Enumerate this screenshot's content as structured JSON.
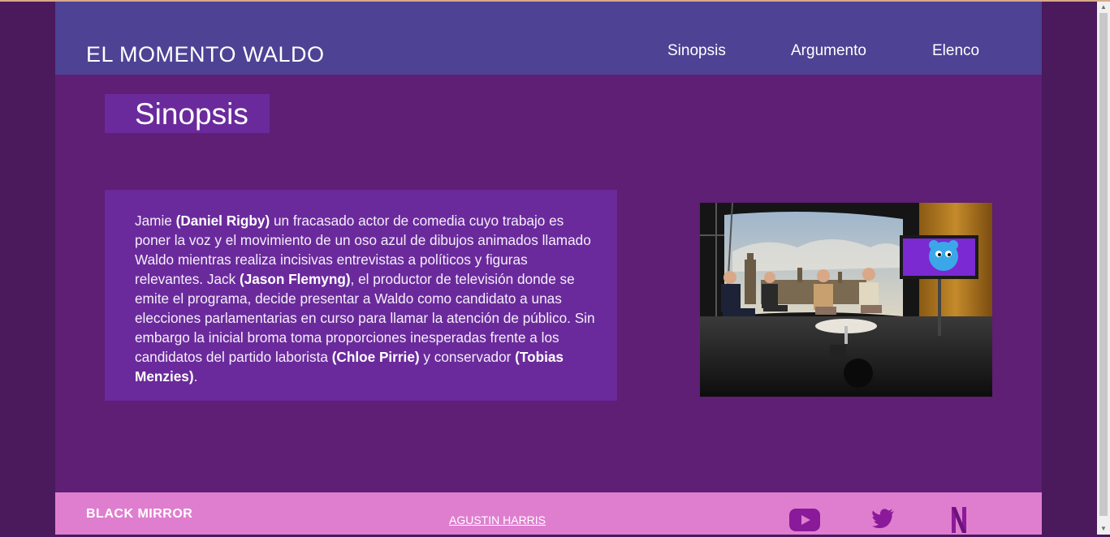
{
  "header": {
    "brand": "EL MOMENTO WALDO",
    "nav": [
      "Sinopsis",
      "Argumento",
      "Elenco"
    ]
  },
  "main": {
    "title": "Sinopsis",
    "synopsis": {
      "p1": "Jamie ",
      "b1": "(Daniel Rigby)",
      "p2": " un fracasado actor de comedia cuyo trabajo es poner la voz y el movimiento de un oso azul de dibujos animados llamado Waldo mientras realiza incisivas entrevistas a políticos y figuras relevantes. Jack ",
      "b2": "(Jason Flemyng)",
      "p3": ", el productor de televisión donde se emite el programa, decide presentar a Waldo como candidato a unas elecciones parlamentarias en curso para llamar la atención de público. Sin embargo la inicial broma toma proporciones inesperadas frente a los candidatos del partido laborista ",
      "b3": "(Chloe Pirrie)",
      "p4": " y conservador ",
      "b4": "(Tobias Menzies)",
      "p5": "."
    },
    "image": {
      "icon": "tv-studio-debate-photo"
    }
  },
  "footer": {
    "logo": "BLACK MIRROR",
    "author_link": "AGUSTIN HARRIS",
    "social": [
      "youtube-icon",
      "twitter-icon",
      "netflix-icon"
    ]
  },
  "colors": {
    "header_bg": "#4d4294",
    "page_bg": "#5e1f74",
    "panel_bg": "#6a2a9c",
    "footer_bg": "#df7ecf",
    "icon_color": "#8a1a9a"
  }
}
